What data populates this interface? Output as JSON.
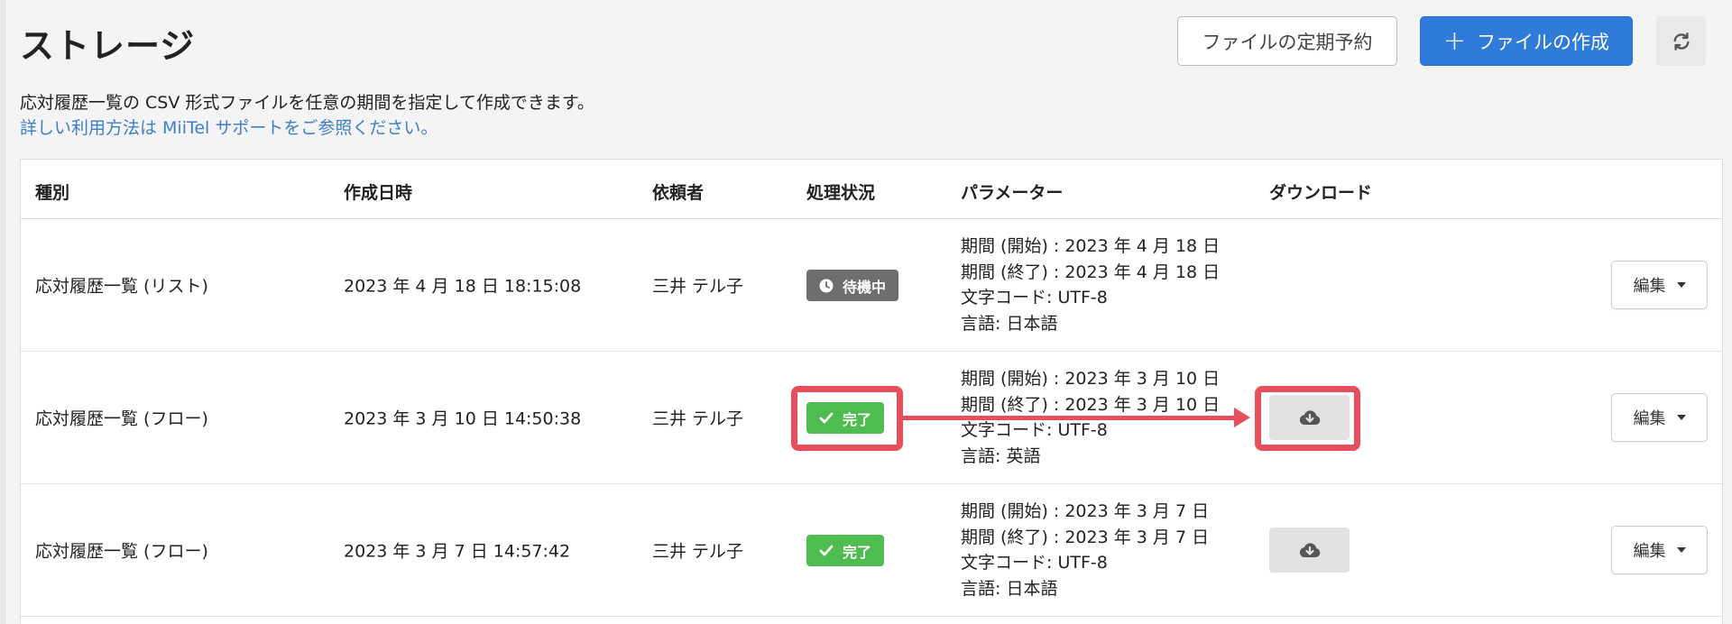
{
  "header": {
    "title": "ストレージ",
    "schedule_button": "ファイルの定期予約",
    "create_button": "ファイルの作成",
    "create_icon": "+",
    "refresh_icon": "refresh-icon"
  },
  "description": {
    "line1": "応対履歴一覧の CSV 形式ファイルを任意の期間を指定して作成できます。",
    "link": "詳しい利用方法は MiiTel サポートをご参照ください。"
  },
  "table": {
    "columns": [
      "種別",
      "作成日時",
      "依頼者",
      "処理状況",
      "パラメーター",
      "ダウンロード"
    ],
    "rows": [
      {
        "type": "応対履歴一覧 (リスト)",
        "created": "2023 年 4 月 18 日 18:15:08",
        "requester": "三井 テル子",
        "status": "待機中",
        "status_kind": "waiting",
        "params": [
          "期間 (開始) : 2023 年 4 月 18 日",
          "期間 (終了) : 2023 年 4 月 18 日",
          "文字コード: UTF-8",
          "言語: 日本語"
        ],
        "download": false,
        "edit": "編集"
      },
      {
        "type": "応対履歴一覧 (フロー)",
        "created": "2023 年 3 月 10 日 14:50:38",
        "requester": "三井 テル子",
        "status": "完了",
        "status_kind": "done",
        "params": [
          "期間 (開始) : 2023 年 3 月 10 日",
          "期間 (終了) : 2023 年 3 月 10 日",
          "文字コード: UTF-8",
          "言語: 英語"
        ],
        "download": true,
        "edit": "編集"
      },
      {
        "type": "応対履歴一覧 (フロー)",
        "created": "2023 年 3 月 7 日 14:57:42",
        "requester": "三井 テル子",
        "status": "完了",
        "status_kind": "done",
        "params": [
          "期間 (開始) : 2023 年 3 月 7 日",
          "期間 (終了) : 2023 年 3 月 7 日",
          "文字コード: UTF-8",
          "言語: 日本語"
        ],
        "download": true,
        "edit": "編集"
      }
    ]
  },
  "colors": {
    "primary": "#2f7bd9",
    "done": "#4ebc4e",
    "waiting": "#6e6e6e",
    "highlight": "#e5505c",
    "link": "#3d7fc9"
  }
}
